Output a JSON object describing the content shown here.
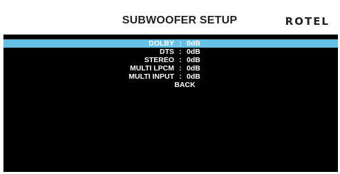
{
  "header": {
    "title": "SUBWOOFER SETUP",
    "brand": "ROTEL"
  },
  "menu": {
    "separator": ":",
    "items": [
      {
        "label": "DOLBY",
        "value": "0dB",
        "selected": true
      },
      {
        "label": "DTS",
        "value": "0dB",
        "selected": false
      },
      {
        "label": "STEREO",
        "value": "0dB",
        "selected": false
      },
      {
        "label": "MULTI LPCM",
        "value": "0dB",
        "selected": false
      },
      {
        "label": "MULTI INPUT",
        "value": "0dB",
        "selected": false
      }
    ],
    "back_label": "BACK"
  },
  "colors": {
    "highlight": "#67c1e6",
    "panel_background": "#000000"
  }
}
